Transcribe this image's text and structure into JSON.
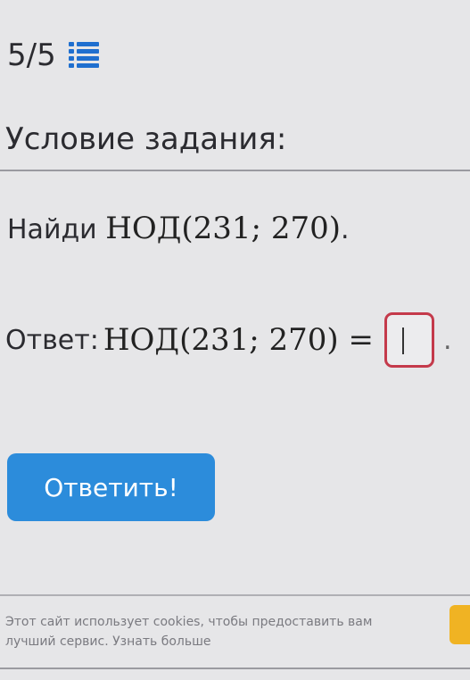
{
  "progress": {
    "count": "5/5",
    "icon": "list-icon"
  },
  "task": {
    "section_title": "Условие задания:",
    "prompt_label": "Найди",
    "expression": "НОД(231; 270)",
    "prompt_end": "."
  },
  "answer": {
    "label": "Ответ:",
    "expression": "НОД(231; 270) =",
    "input_value": "",
    "suffix": "."
  },
  "submit": {
    "label": "Ответить!"
  },
  "cookie": {
    "text": "Этот сайт использует cookies, чтобы предоставить вам лучший сервис.",
    "link": "Узнать больше"
  },
  "colors": {
    "accent": "#2c8cdb",
    "input_border": "#c43a4b",
    "cookie_button": "#f0b323",
    "list_icon": "#1f6fcf"
  }
}
